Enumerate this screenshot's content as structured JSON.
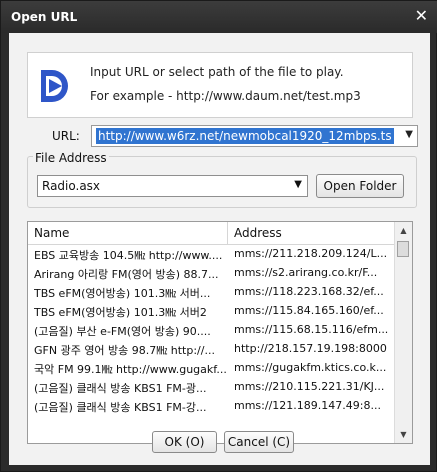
{
  "window": {
    "title": "Open URL",
    "close_glyph": "✕"
  },
  "info": {
    "line1": "Input URL or select path of the file to play.",
    "line2": "For example - http://www.daum.net/test.mp3",
    "logo_color": "#2f56c8"
  },
  "url": {
    "label": "URL:",
    "value": "http://www.w6rz.net/newmobcal1920_12mbps.ts"
  },
  "file_address": {
    "label": "File Address",
    "selected": "Radio.asx",
    "open_folder_label": "Open Folder"
  },
  "list": {
    "columns": [
      "Name",
      "Address"
    ],
    "rows": [
      [
        "EBS 교육방송 104.5㎒ http://www....",
        "mms://211.218.209.124/L..."
      ],
      [
        "Arirang 아리랑 FM(영어 방송) 88.7...",
        "mms://s2.arirang.co.kr/F..."
      ],
      [
        "TBS eFM(영어방송) 101.3㎒ 서버...",
        "mms://118.223.168.32/ef..."
      ],
      [
        "TBS eFM(영어방송) 101.3㎒ 서버2",
        "mms://115.84.165.160/ef..."
      ],
      [
        "(고음질) 부산 e-FM(영어 방송) 90....",
        "mms://115.68.15.116/efm..."
      ],
      [
        "GFN 광주 영어 방송 98.7㎒ http://...",
        "http://218.157.19.198:8000"
      ],
      [
        "국악 FM 99.1㎒ http://www.gugakf...",
        "mms://gugakfm.ktics.co.k..."
      ],
      [
        "(고음질) 클래식 방송 KBS1 FM-광...",
        "mms://210.115.221.31/KJ..."
      ],
      [
        "(고음질) 클래식 방송 KBS1 FM-강...",
        "mms://121.189.147.49:8..."
      ]
    ]
  },
  "buttons": {
    "ok": "OK (O)",
    "cancel": "Cancel (C)"
  }
}
